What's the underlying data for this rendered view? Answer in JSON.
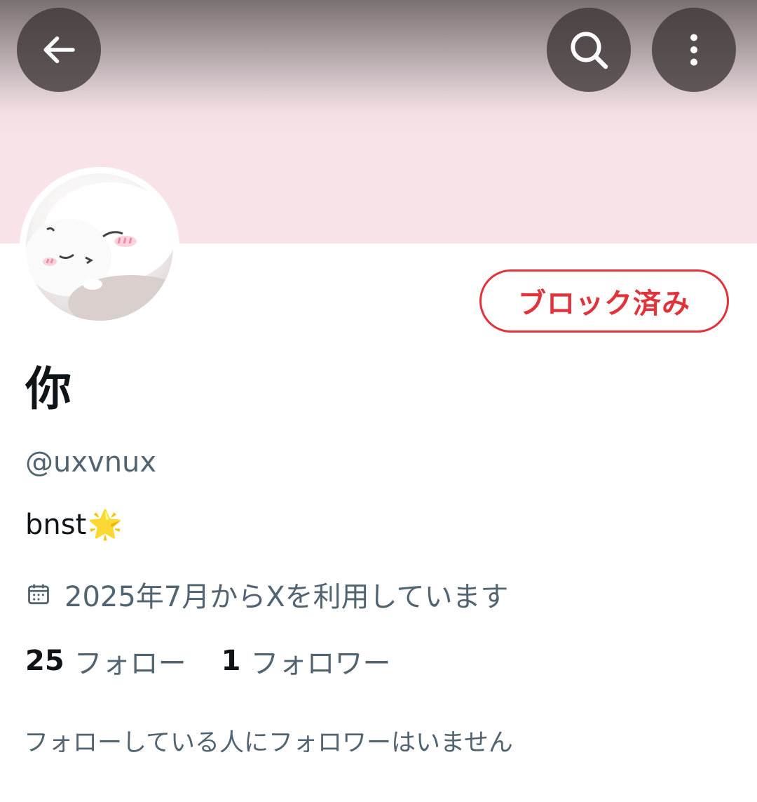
{
  "header": {
    "back_icon": "arrow-left-icon",
    "search_icon": "search-icon",
    "more_icon": "more-vertical-icon",
    "banner_color": "#f8e3e8"
  },
  "profile": {
    "display_name": "你",
    "handle": "@uxvnux",
    "bio_text": "bnst",
    "bio_emoji": "🌟",
    "joined_icon": "calendar-icon",
    "joined_text": "2025年7月からXを利用しています",
    "block_button_label": "ブロック済み",
    "block_color": "#e0333a"
  },
  "stats": {
    "following_count": "25",
    "following_label": "フォロー",
    "followers_count": "1",
    "followers_label": "フォロワー"
  },
  "notice": {
    "followers_you_know": "フォローしている人にフォロワーはいません"
  }
}
